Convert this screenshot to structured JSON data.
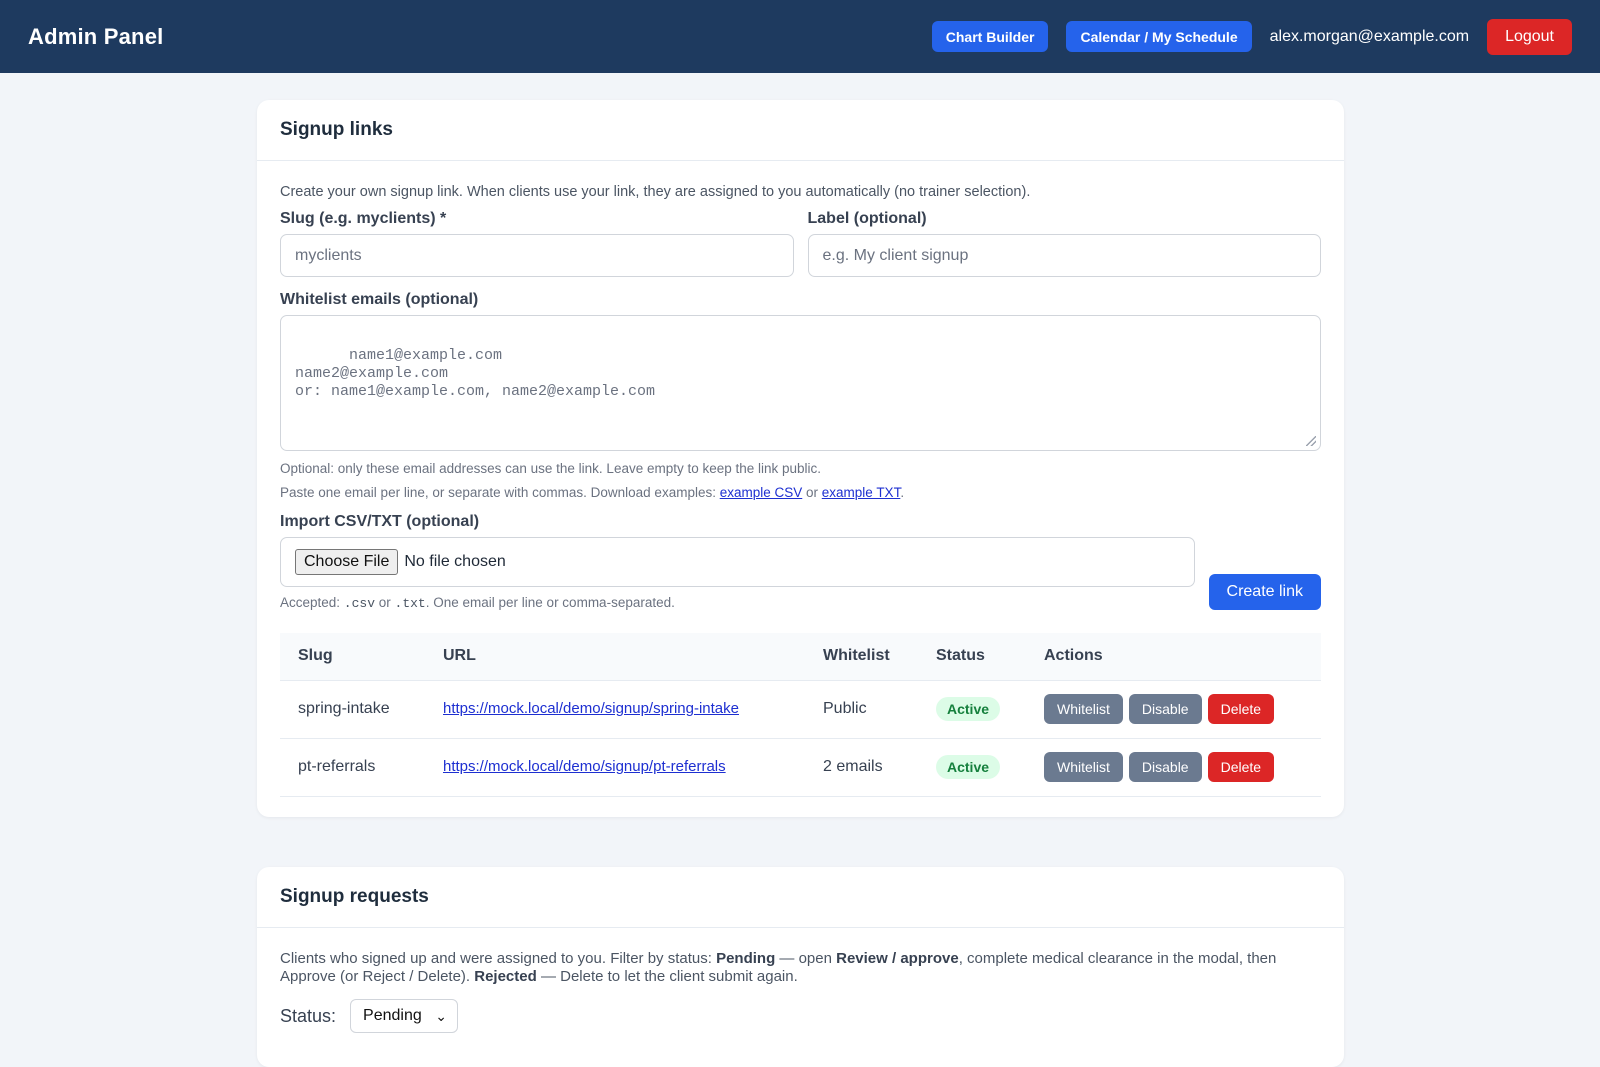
{
  "header": {
    "title": "Admin Panel",
    "nav": {
      "chart_builder": "Chart Builder",
      "calendar": "Calendar / My Schedule"
    },
    "user_email": "alex.morgan@example.com",
    "logout": "Logout",
    "colors": {
      "bar": "#1e3a5f",
      "primary": "#2563eb",
      "danger": "#dc2626"
    }
  },
  "signup_links": {
    "title": "Signup links",
    "intro": "Create your own signup link. When clients use your link, they are assigned to you automatically (no trainer selection).",
    "slug_label": "Slug (e.g. myclients) *",
    "slug_placeholder": "myclients",
    "label_label": "Label (optional)",
    "label_placeholder": "e.g. My client signup",
    "whitelist_label": "Whitelist emails (optional)",
    "whitelist_placeholder": "name1@example.com\nname2@example.com\nor: name1@example.com, name2@example.com",
    "hint_1": "Optional: only these email addresses can use the link. Leave empty to keep the link public.",
    "hint_2_prefix": "Paste one email per line, or separate with commas. Download examples: ",
    "hint_2_csv": "example CSV",
    "hint_2_or": " or ",
    "hint_2_txt": "example TXT",
    "hint_2_end": ".",
    "import_label": "Import CSV/TXT (optional)",
    "choose_file": "Choose File",
    "no_file": "No file chosen",
    "accepted_prefix": "Accepted: ",
    "accepted_csv": ".csv",
    "accepted_or": " or ",
    "accepted_txt": ".txt",
    "accepted_suffix": ". One email per line or comma-separated.",
    "create_button": "Create link",
    "table": {
      "headers": {
        "slug": "Slug",
        "url": "URL",
        "whitelist": "Whitelist",
        "status": "Status",
        "actions": "Actions"
      },
      "rows": [
        {
          "slug": "spring-intake",
          "url": "https://mock.local/demo/signup/spring-intake",
          "whitelist": "Public",
          "status": "Active",
          "actions": {
            "whitelist": "Whitelist",
            "disable": "Disable",
            "delete": "Delete"
          }
        },
        {
          "slug": "pt-referrals",
          "url": "https://mock.local/demo/signup/pt-referrals",
          "whitelist": "2 emails",
          "status": "Active",
          "actions": {
            "whitelist": "Whitelist",
            "disable": "Disable",
            "delete": "Delete"
          }
        }
      ]
    }
  },
  "signup_requests": {
    "title": "Signup requests",
    "intro_1": "Clients who signed up and were assigned to you. Filter by status: ",
    "intro_pending": "Pending",
    "intro_2": " — open ",
    "intro_review": "Review / approve",
    "intro_3": ", complete medical clearance in the modal, then Approve (or Reject / Delete). ",
    "intro_rejected": "Rejected",
    "intro_4": " — Delete to let the client submit again.",
    "status_label": "Status:",
    "status_value": "Pending"
  }
}
